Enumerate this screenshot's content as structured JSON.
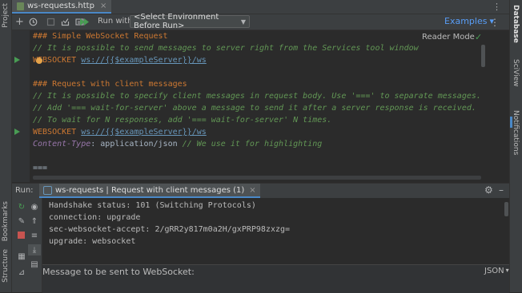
{
  "left_strip": {
    "project_label": "Project",
    "bookmarks_label": "Bookmarks",
    "structure_label": "Structure"
  },
  "right_strip": {
    "database_label": "Database",
    "sciview_label": "SciView",
    "notifications_label": "Notifications"
  },
  "tab": {
    "label": "ws-requests.http",
    "close": "×"
  },
  "toolbar": {
    "run_with_label": "Run with:",
    "environment_select": "<Select Environment Before Run>",
    "examples_label": "Examples",
    "examples_chevron": "▾"
  },
  "editor": {
    "reader_mode_label": "Reader Mode",
    "lines": [
      {
        "kind": "hdr",
        "text": "### Simple WebSocket Request"
      },
      {
        "kind": "cmt",
        "text": "// It is possible to send messages to server right from the Services tool window"
      },
      {
        "kind": "req",
        "method": "WEBSOCKET",
        "url": "ws://{{$exampleServer}}/ws"
      },
      {
        "kind": "blank",
        "text": ""
      },
      {
        "kind": "hdr",
        "text": "### Request with client messages"
      },
      {
        "kind": "cmt",
        "text": "// It is possible to specify client messages in request body. Use '===' to separate messages."
      },
      {
        "kind": "cmt",
        "text": "// Add '=== wait-for-server' above a message to send it after a server response is received."
      },
      {
        "kind": "cmt",
        "text": "// To wait for N responses, add '=== wait-for-server' N times."
      },
      {
        "kind": "req",
        "method": "WEBSOCKET",
        "url": "ws://{{$exampleServer}}/ws"
      },
      {
        "kind": "header",
        "key": "Content-Type",
        "value": ": application/json ",
        "comment": "// We use it for highlighting"
      },
      {
        "kind": "blank",
        "text": ""
      },
      {
        "kind": "plain",
        "text": "==="
      },
      {
        "kind": "plain",
        "text": "{"
      }
    ]
  },
  "run": {
    "label": "Run:",
    "tab_label": "ws-requests | Request with client messages (1)",
    "output": [
      "Handshake status: 101 (Switching Protocols)",
      "connection: upgrade",
      "sec-websocket-accept: 2/gRR2y817m0a2H/gxPRP98zxzg=",
      "upgrade: websocket"
    ],
    "message_placeholder": "Message to be sent to WebSocket:",
    "format_select": "JSON"
  },
  "colors": {
    "accent": "#4a88c7",
    "run_green": "#499c54",
    "stop_red": "#c75450"
  }
}
